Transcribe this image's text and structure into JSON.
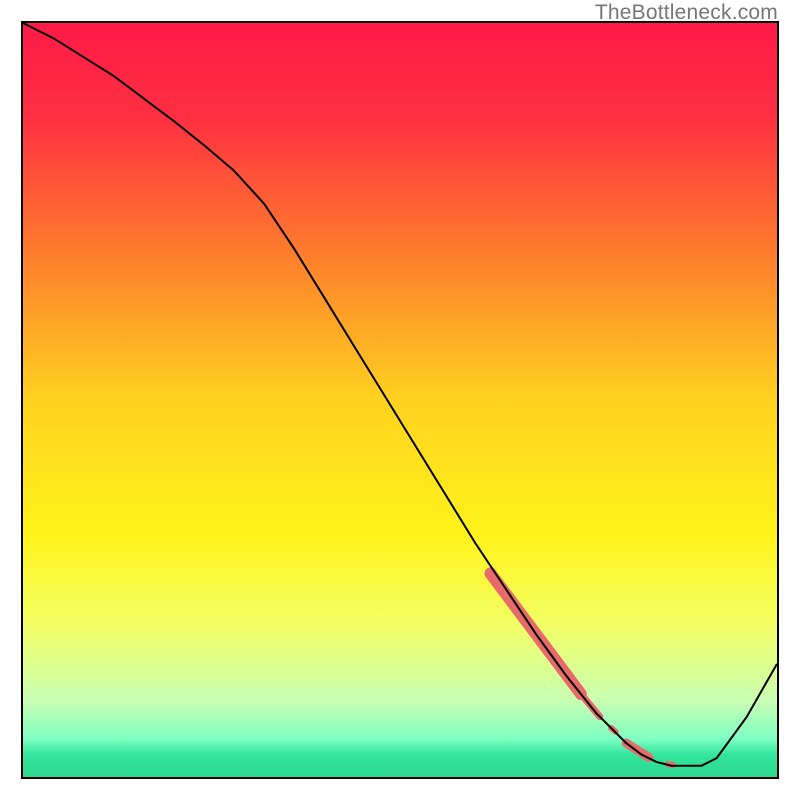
{
  "watermark": "TheBottleneck.com",
  "chart_data": {
    "type": "line",
    "title": "",
    "xlabel": "",
    "ylabel": "",
    "xlim": [
      0,
      100
    ],
    "ylim": [
      0,
      100
    ],
    "grid": false,
    "legend": false,
    "background_gradient": {
      "stops": [
        {
          "pct": 0,
          "color": "#ff1a47"
        },
        {
          "pct": 12,
          "color": "#ff2e42"
        },
        {
          "pct": 30,
          "color": "#ff7a2d"
        },
        {
          "pct": 50,
          "color": "#ffd21f"
        },
        {
          "pct": 68,
          "color": "#fff31a"
        },
        {
          "pct": 80,
          "color": "#f2ff66"
        },
        {
          "pct": 90,
          "color": "#c8ffb3"
        },
        {
          "pct": 95,
          "color": "#7dffc2"
        },
        {
          "pct": 97,
          "color": "#33e59e"
        },
        {
          "pct": 100,
          "color": "#2cd98c"
        }
      ]
    },
    "series": [
      {
        "name": "bottleneck-curve",
        "color": "#000000",
        "width": 2,
        "x": [
          0,
          4,
          8,
          12,
          16,
          20,
          24,
          28,
          32,
          36,
          40,
          44,
          48,
          52,
          56,
          60,
          64,
          68,
          72,
          76,
          80,
          82,
          84,
          86,
          90,
          92,
          96,
          100
        ],
        "y": [
          100,
          98,
          95.5,
          93,
          90,
          87,
          83.8,
          80.4,
          76,
          70,
          63.5,
          57,
          50.5,
          44,
          37.5,
          31,
          25,
          19,
          13.5,
          8.5,
          4.5,
          3,
          2,
          1.5,
          1.5,
          2.5,
          8,
          15
        ]
      }
    ],
    "highlight_segments": [
      {
        "name": "thick-streak",
        "color": "#e86b6b",
        "width": 12,
        "x": [
          62,
          74
        ],
        "y": [
          27,
          11
        ]
      },
      {
        "name": "taper-1",
        "color": "#e86b6b",
        "width": 7,
        "x": [
          74,
          76.5
        ],
        "y": [
          11,
          8
        ]
      },
      {
        "name": "dot-1",
        "color": "#e86b6b",
        "width": 6,
        "x": [
          78,
          78.6
        ],
        "y": [
          6.5,
          6
        ]
      },
      {
        "name": "small-streak",
        "color": "#e86b6b",
        "width": 9,
        "x": [
          80,
          83
        ],
        "y": [
          4.5,
          2.6
        ]
      },
      {
        "name": "dot-2",
        "color": "#e86b6b",
        "width": 6,
        "x": [
          85.5,
          86.2
        ],
        "y": [
          1.7,
          1.6
        ]
      }
    ]
  }
}
